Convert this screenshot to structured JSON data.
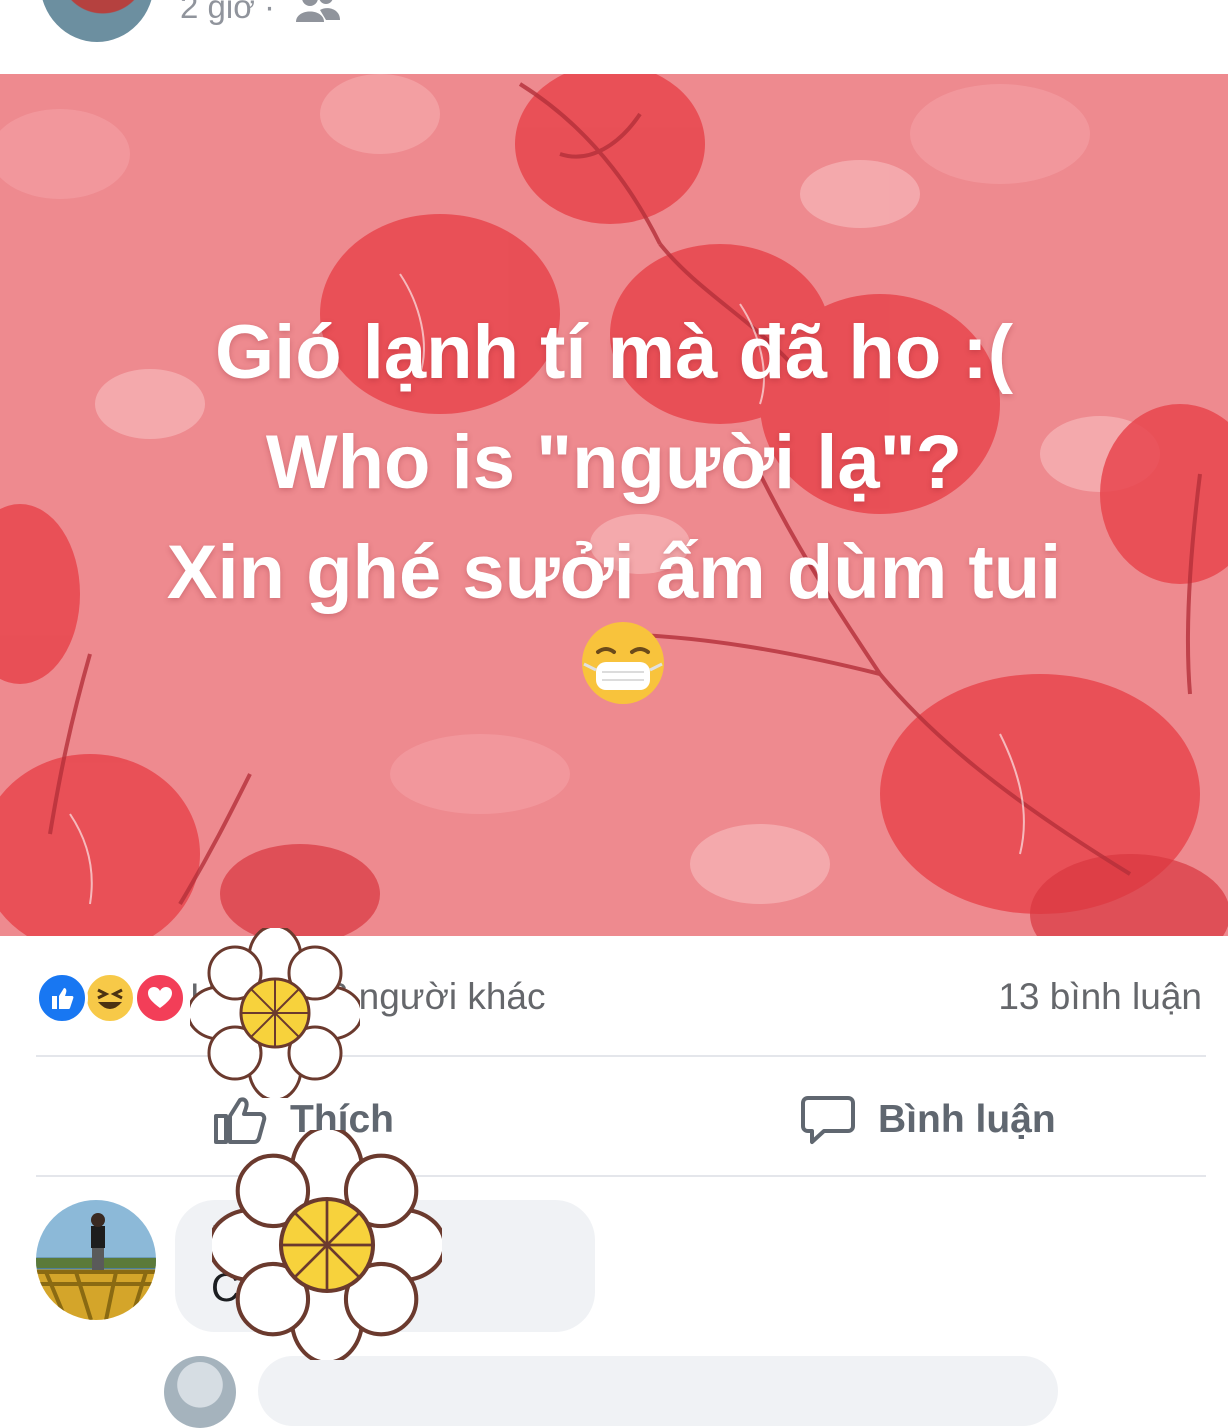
{
  "post": {
    "time": "2 giờ ·",
    "audience_icon": "friends-icon",
    "text_lines": [
      "Gió lạnh tí mà đã ho :(",
      "Who is \"người lạ\"?",
      "Xin ghé sưởi ấm dùm tui"
    ],
    "emoji": "mask-emoji",
    "background_color": "#ee8a8f"
  },
  "reactions": {
    "icons": [
      "like-icon",
      "haha-icon",
      "love-icon"
    ],
    "names_text": "H          g và 66 người khác",
    "comment_count": "13 bình luận"
  },
  "actions": {
    "like_label": "Thích",
    "comment_label": "Bình luận"
  },
  "comment": {
    "author": "N                    g",
    "text": "C           Hoà :0"
  },
  "colors": {
    "like_blue": "#1877f2",
    "love_red": "#f33e58",
    "haha_yellow": "#f7c948",
    "action_gray": "#606770",
    "bubble_gray": "#f0f2f5"
  }
}
